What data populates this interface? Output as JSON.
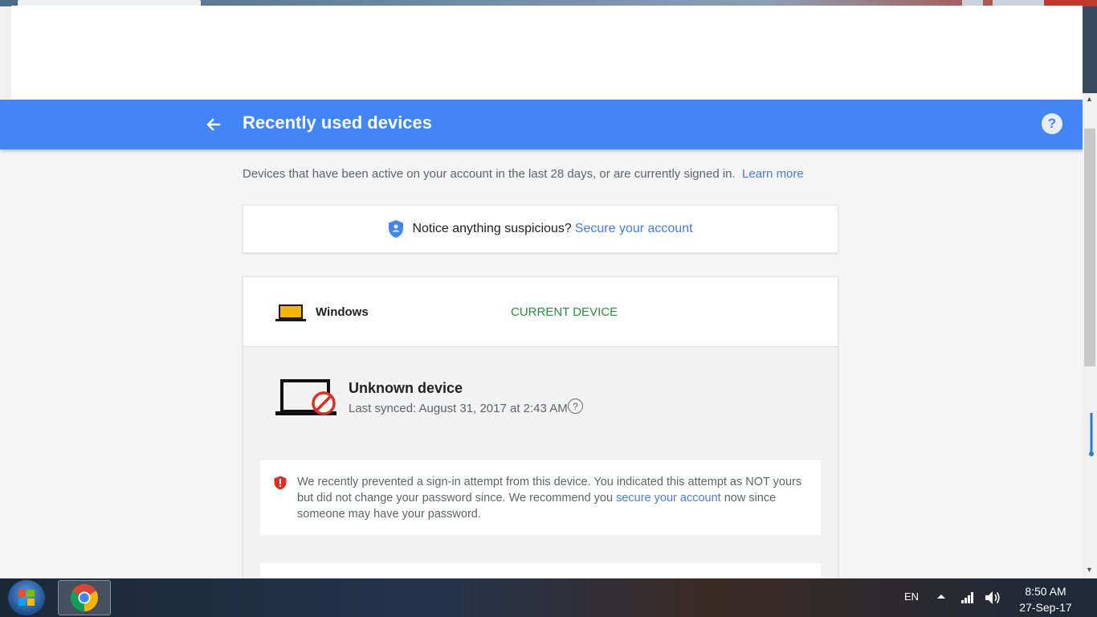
{
  "header": {
    "title": "Recently used devices",
    "back_icon": "arrow-left-icon",
    "help_label": "?"
  },
  "intro": {
    "text": "Devices that have been active on your account in the last 28 days, or are currently signed in.",
    "learn_more": "Learn more"
  },
  "notice": {
    "icon": "shield-icon",
    "text": "Notice anything suspicious?",
    "link": "Secure your account"
  },
  "devices": [
    {
      "name": "Windows",
      "status": "CURRENT DEVICE",
      "icon": "laptop-icon"
    },
    {
      "name": "Unknown device",
      "last_synced": "Last synced: August 31, 2017 at 2:43 AM",
      "icon": "blocked-laptop-icon",
      "help_label": "?",
      "alert": {
        "icon": "warning-shield-icon",
        "text_before": "We recently prevented a sign-in attempt from this device. You indicated this attempt as NOT yours but did not change your password since. We recommend you",
        "link": "secure your account",
        "text_after": "now since someone may have your password."
      }
    }
  ],
  "taskbar": {
    "language": "EN",
    "time": "8:50 AM",
    "date": "27-Sep-17"
  },
  "colors": {
    "app_bar": "#4285f4",
    "link": "#4a7bd6",
    "current_device": "#2e8b3e",
    "alert_red": "#d93025"
  }
}
